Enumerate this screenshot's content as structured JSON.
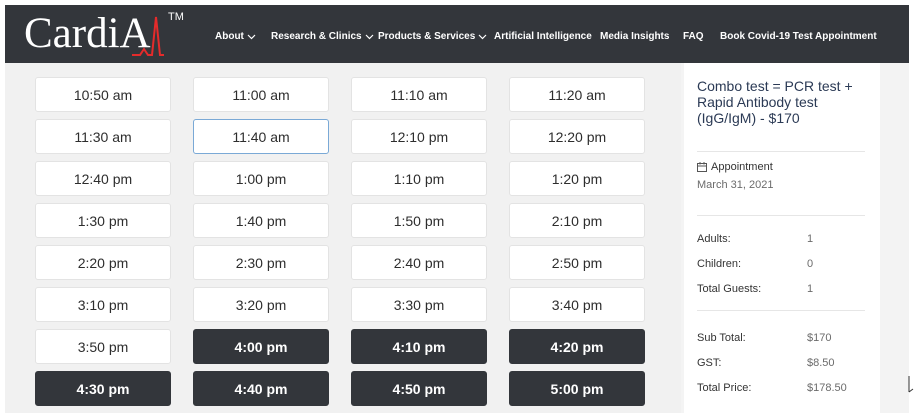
{
  "brand": {
    "logo_text": "CardiA",
    "trademark": "TM",
    "accent_color": "#e52b2b"
  },
  "nav": {
    "items": [
      {
        "label": "About",
        "dropdown": true
      },
      {
        "label": "Research & Clinics",
        "dropdown": true
      },
      {
        "label": "Products & Services",
        "dropdown": true
      },
      {
        "label": "Artificial Intelligence",
        "dropdown": false
      },
      {
        "label": "Media Insights",
        "dropdown": false
      },
      {
        "label": "FAQ",
        "dropdown": false
      },
      {
        "label": "Book Covid-19 Test Appointment",
        "dropdown": false
      }
    ]
  },
  "time_slots": {
    "rows": [
      [
        {
          "label": "10:50 am",
          "state": "available"
        },
        {
          "label": "11:00 am",
          "state": "available"
        },
        {
          "label": "11:10 am",
          "state": "available"
        },
        {
          "label": "11:20 am",
          "state": "available"
        }
      ],
      [
        {
          "label": "11:30 am",
          "state": "available"
        },
        {
          "label": "11:40 am",
          "state": "selected"
        },
        {
          "label": "12:10 pm",
          "state": "available"
        },
        {
          "label": "12:20 pm",
          "state": "available"
        }
      ],
      [
        {
          "label": "12:40 pm",
          "state": "available"
        },
        {
          "label": "1:00 pm",
          "state": "available"
        },
        {
          "label": "1:10 pm",
          "state": "available"
        },
        {
          "label": "1:20 pm",
          "state": "available"
        }
      ],
      [
        {
          "label": "1:30 pm",
          "state": "available"
        },
        {
          "label": "1:40 pm",
          "state": "available"
        },
        {
          "label": "1:50 pm",
          "state": "available"
        },
        {
          "label": "2:10 pm",
          "state": "available"
        }
      ],
      [
        {
          "label": "2:20 pm",
          "state": "available"
        },
        {
          "label": "2:30 pm",
          "state": "available"
        },
        {
          "label": "2:40 pm",
          "state": "available"
        },
        {
          "label": "2:50 pm",
          "state": "available"
        }
      ],
      [
        {
          "label": "3:10 pm",
          "state": "available"
        },
        {
          "label": "3:20 pm",
          "state": "available"
        },
        {
          "label": "3:30 pm",
          "state": "available"
        },
        {
          "label": "3:40 pm",
          "state": "available"
        }
      ],
      [
        {
          "label": "3:50 pm",
          "state": "available"
        },
        {
          "label": "4:00 pm",
          "state": "unavailable"
        },
        {
          "label": "4:10 pm",
          "state": "unavailable"
        },
        {
          "label": "4:20 pm",
          "state": "unavailable"
        }
      ],
      [
        {
          "label": "4:30 pm",
          "state": "unavailable"
        },
        {
          "label": "4:40 pm",
          "state": "unavailable"
        },
        {
          "label": "4:50 pm",
          "state": "unavailable"
        },
        {
          "label": "5:00 pm",
          "state": "unavailable"
        }
      ]
    ]
  },
  "summary": {
    "product_title": "Combo test = PCR test + Rapid Antibody test (IgG/IgM) - $170",
    "appointment_label": "Appointment",
    "appointment_date": "March 31, 2021",
    "guests": [
      {
        "label": "Adults:",
        "value": "1"
      },
      {
        "label": "Children:",
        "value": "0"
      },
      {
        "label": "Total Guests:",
        "value": "1"
      }
    ],
    "totals": [
      {
        "label": "Sub Total:",
        "value": "$170"
      },
      {
        "label": "GST:",
        "value": "$8.50"
      },
      {
        "label": "Total Price:",
        "value": "$178.50"
      }
    ]
  },
  "colors": {
    "nav_bg": "#33363b",
    "unavailable_bg": "#33363b",
    "selected_border": "#7aa9d6",
    "panel_bg": "#f1f1f1",
    "title_color": "#2b3a55"
  }
}
